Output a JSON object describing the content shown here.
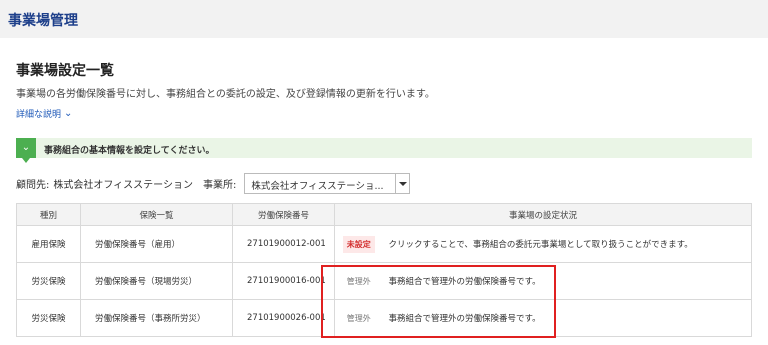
{
  "header": {
    "title": "事業場管理"
  },
  "page": {
    "title": "事業場設定一覧",
    "description": "事業場の各労働保険番号に対し、事務組合との委託の設定、及び登録情報の更新を行います。",
    "details_link": "詳細な説明"
  },
  "notice": {
    "text": "事務組合の基本情報を設定してください。"
  },
  "filter": {
    "client_label": "顧問先:",
    "client_value": "株式会社オフィスステーション",
    "office_label": "事業所:",
    "office_selected": "株式会社オフィスステーショ..."
  },
  "table": {
    "headers": [
      "種別",
      "保険一覧",
      "労働保険番号",
      "事業場の設定状況"
    ],
    "rows": [
      {
        "type": "雇用保険",
        "insurance": "労働保険番号（雇用）",
        "number": "27101900012-001",
        "badge": "未設定",
        "status": "クリックすることで、事務組合の委託元事業場として取り扱うことができます。"
      },
      {
        "type": "労災保険",
        "insurance": "労働保険番号（現場労災）",
        "number": "27101900016-001",
        "badge": "管理外",
        "status": "事務組合で管理外の労働保険番号です。"
      },
      {
        "type": "労災保険",
        "insurance": "労働保険番号（事務所労災）",
        "number": "27101900026-001",
        "badge": "管理外",
        "status": "事務組合で管理外の労働保険番号です。"
      }
    ]
  },
  "colors": {
    "brand": "#1d3f8a",
    "link": "#1d58b8",
    "notice_bg": "#eaf5e6",
    "notice_badge": "#4caf50",
    "unset_badge": "#d32f2f",
    "highlight": "#e02020"
  },
  "icons": {
    "notice": "chevron-down-icon",
    "details": "chevron-down-icon",
    "select": "triangle-down-icon"
  }
}
